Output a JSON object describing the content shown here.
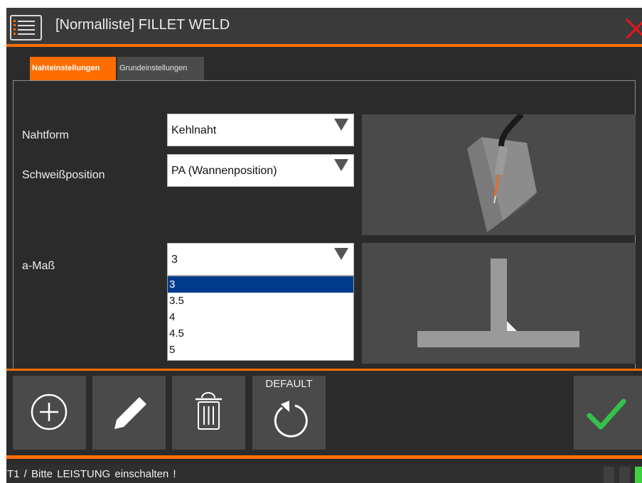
{
  "window": {
    "title": "[Normalliste] FILLET WELD"
  },
  "tabs": [
    {
      "label": "Nahteinstellungen",
      "active": true
    },
    {
      "label": "Grundeinstellungen",
      "active": false
    }
  ],
  "form": {
    "nahtform": {
      "label": "Nahtform",
      "value": "Kehlnaht"
    },
    "schweissposition": {
      "label": "Schweißposition",
      "value": "PA (Wannenposition)"
    },
    "a_mass": {
      "label": "a-Maß",
      "value": "3",
      "options": [
        "3",
        "3.5",
        "4",
        "4.5",
        "5"
      ],
      "selected_option": "3"
    }
  },
  "toolbar": {
    "add_icon": "plus-circle-icon",
    "edit_icon": "pencil-icon",
    "delete_icon": "trash-icon",
    "default_label": "DEFAULT",
    "default_icon": "reset-icon",
    "confirm_icon": "checkmark-icon"
  },
  "status": {
    "text": "T1 / Bitte LEISTUNG einschalten !"
  },
  "colors": {
    "accent": "#ff6d00",
    "background": "#2b2b2b",
    "selection": "#003a8c",
    "confirm": "#34c24a",
    "close": "#e8141c"
  }
}
